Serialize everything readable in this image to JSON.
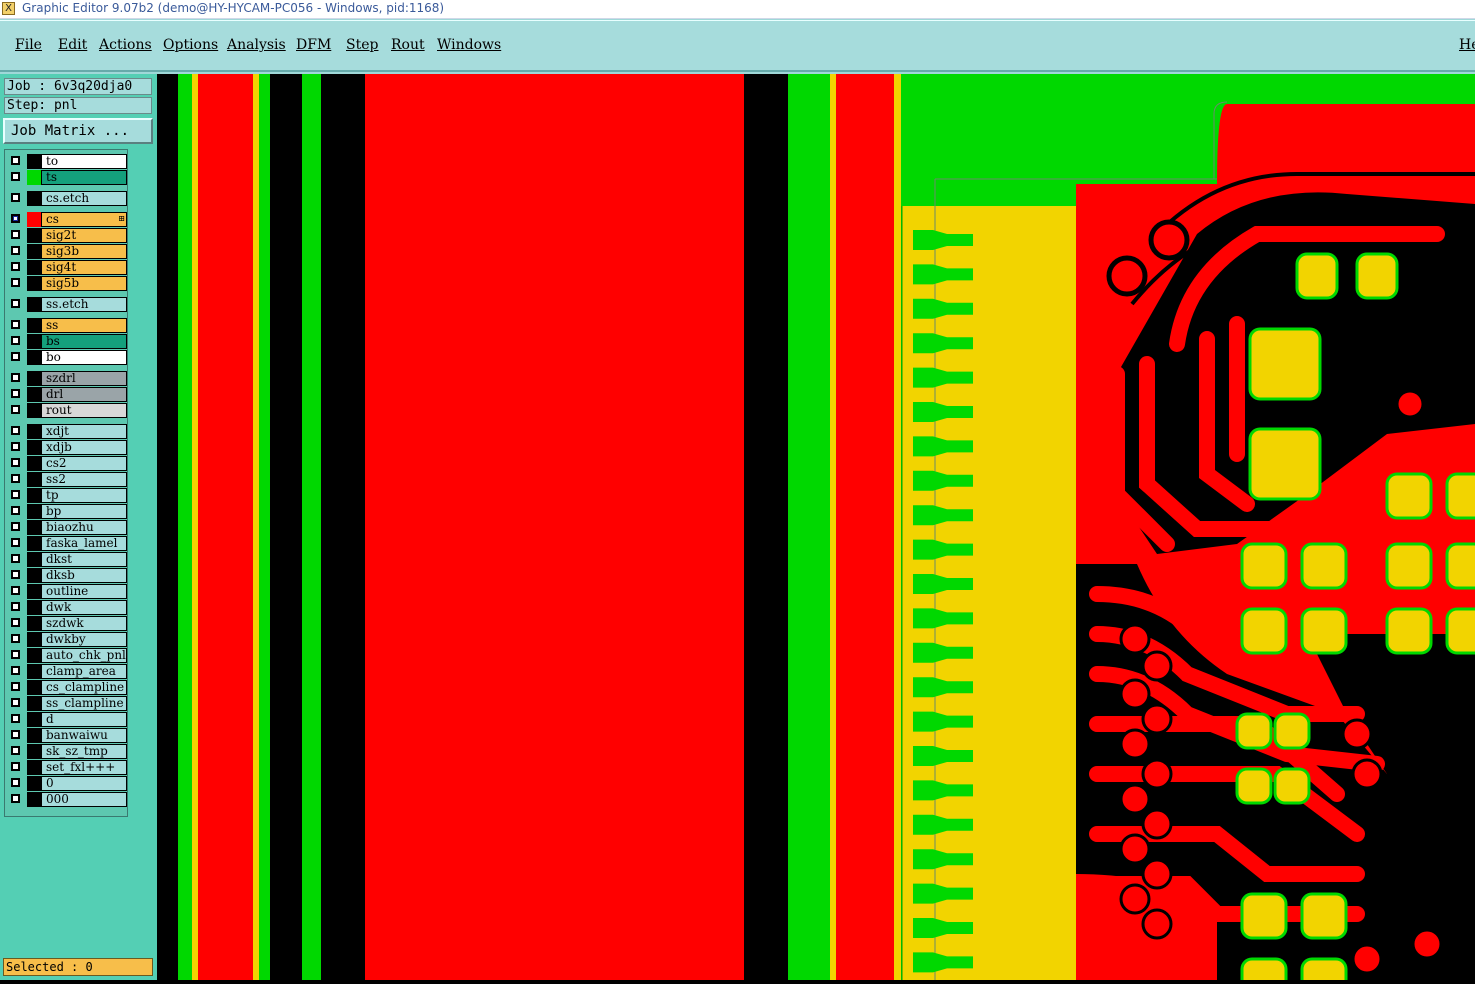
{
  "window": {
    "title": "Graphic Editor 9.07b2 (demo@HY-HYCAM-PC056 - Windows, pid:1168)"
  },
  "menu": {
    "items": [
      "File",
      "Edit",
      "Actions",
      "Options",
      "Analysis",
      "DFM",
      "Step",
      "Rout",
      "Windows"
    ],
    "help": "He"
  },
  "job": {
    "job_label": "Job : 6v3q20dja0",
    "step_label": "Step: pnl",
    "matrix_button": "Job Matrix ..."
  },
  "layers": [
    {
      "name": "to",
      "bg": "#ffffff",
      "swatch": "#000000",
      "group": 0
    },
    {
      "name": "ts",
      "bg": "#14a07c",
      "swatch": "#00d800",
      "group": 0
    },
    {
      "name": "cs.etch",
      "bg": "#a6dcdc",
      "swatch": "#000000",
      "group": 1
    },
    {
      "name": "cs",
      "bg": "#f7be4a",
      "swatch": "#ff0000",
      "group": 2,
      "active": true,
      "marker": "⊞"
    },
    {
      "name": "sig2t",
      "bg": "#f7be4a",
      "swatch": "#000000",
      "group": 2
    },
    {
      "name": "sig3b",
      "bg": "#f7be4a",
      "swatch": "#000000",
      "group": 2
    },
    {
      "name": "sig4t",
      "bg": "#f7be4a",
      "swatch": "#000000",
      "group": 2
    },
    {
      "name": "sig5b",
      "bg": "#f7be4a",
      "swatch": "#000000",
      "group": 2
    },
    {
      "name": "ss.etch",
      "bg": "#a6dcdc",
      "swatch": "#000000",
      "group": 3
    },
    {
      "name": "ss",
      "bg": "#f7be4a",
      "swatch": "#000000",
      "group": 4
    },
    {
      "name": "bs",
      "bg": "#14a07c",
      "swatch": "#000000",
      "group": 4
    },
    {
      "name": "bo",
      "bg": "#ffffff",
      "swatch": "#000000",
      "group": 4
    },
    {
      "name": "szdrl",
      "bg": "#9aa4a8",
      "swatch": "#000000",
      "group": 5
    },
    {
      "name": "drl",
      "bg": "#9aa4a8",
      "swatch": "#000000",
      "group": 5
    },
    {
      "name": "rout",
      "bg": "#d8d8d8",
      "swatch": "#000000",
      "group": 5
    },
    {
      "name": "xdjt",
      "bg": "#a6dcdc",
      "swatch": "#000000",
      "group": 6
    },
    {
      "name": "xdjb",
      "bg": "#a6dcdc",
      "swatch": "#000000",
      "group": 6
    },
    {
      "name": "cs2",
      "bg": "#a6dcdc",
      "swatch": "#000000",
      "group": 6
    },
    {
      "name": "ss2",
      "bg": "#a6dcdc",
      "swatch": "#000000",
      "group": 6
    },
    {
      "name": "tp",
      "bg": "#a6dcdc",
      "swatch": "#000000",
      "group": 6
    },
    {
      "name": "bp",
      "bg": "#a6dcdc",
      "swatch": "#000000",
      "group": 6
    },
    {
      "name": "biaozhu",
      "bg": "#a6dcdc",
      "swatch": "#000000",
      "group": 6
    },
    {
      "name": "faska_lamel",
      "bg": "#a6dcdc",
      "swatch": "#000000",
      "group": 6
    },
    {
      "name": "dkst",
      "bg": "#a6dcdc",
      "swatch": "#000000",
      "group": 6
    },
    {
      "name": "dksb",
      "bg": "#a6dcdc",
      "swatch": "#000000",
      "group": 6
    },
    {
      "name": "outline",
      "bg": "#a6dcdc",
      "swatch": "#000000",
      "group": 6
    },
    {
      "name": "dwk",
      "bg": "#a6dcdc",
      "swatch": "#000000",
      "group": 6
    },
    {
      "name": "szdwk",
      "bg": "#a6dcdc",
      "swatch": "#000000",
      "group": 6
    },
    {
      "name": "dwkby",
      "bg": "#a6dcdc",
      "swatch": "#000000",
      "group": 6
    },
    {
      "name": "auto_chk_pnl",
      "bg": "#a6dcdc",
      "swatch": "#000000",
      "group": 6
    },
    {
      "name": "clamp_area",
      "bg": "#a6dcdc",
      "swatch": "#000000",
      "group": 6
    },
    {
      "name": "cs_clampline",
      "bg": "#a6dcdc",
      "swatch": "#000000",
      "group": 6
    },
    {
      "name": "ss_clampline",
      "bg": "#a6dcdc",
      "swatch": "#000000",
      "group": 6
    },
    {
      "name": "d",
      "bg": "#a6dcdc",
      "swatch": "#000000",
      "group": 6
    },
    {
      "name": "banwaiwu",
      "bg": "#a6dcdc",
      "swatch": "#000000",
      "group": 6
    },
    {
      "name": "sk_sz_tmp",
      "bg": "#a6dcdc",
      "swatch": "#000000",
      "group": 6
    },
    {
      "name": "set_fxl+++",
      "bg": "#a6dcdc",
      "swatch": "#000000",
      "group": 6
    },
    {
      "name": "0",
      "bg": "#a6dcdc",
      "swatch": "#000000",
      "group": 6
    },
    {
      "name": "000",
      "bg": "#a6dcdc",
      "swatch": "#000000",
      "group": 6
    }
  ],
  "status": {
    "selected": "Selected : 0"
  },
  "colors": {
    "copper": "#ff0000",
    "soldermask": "#00d800",
    "pad": "#f2d400",
    "background": "#000000"
  }
}
